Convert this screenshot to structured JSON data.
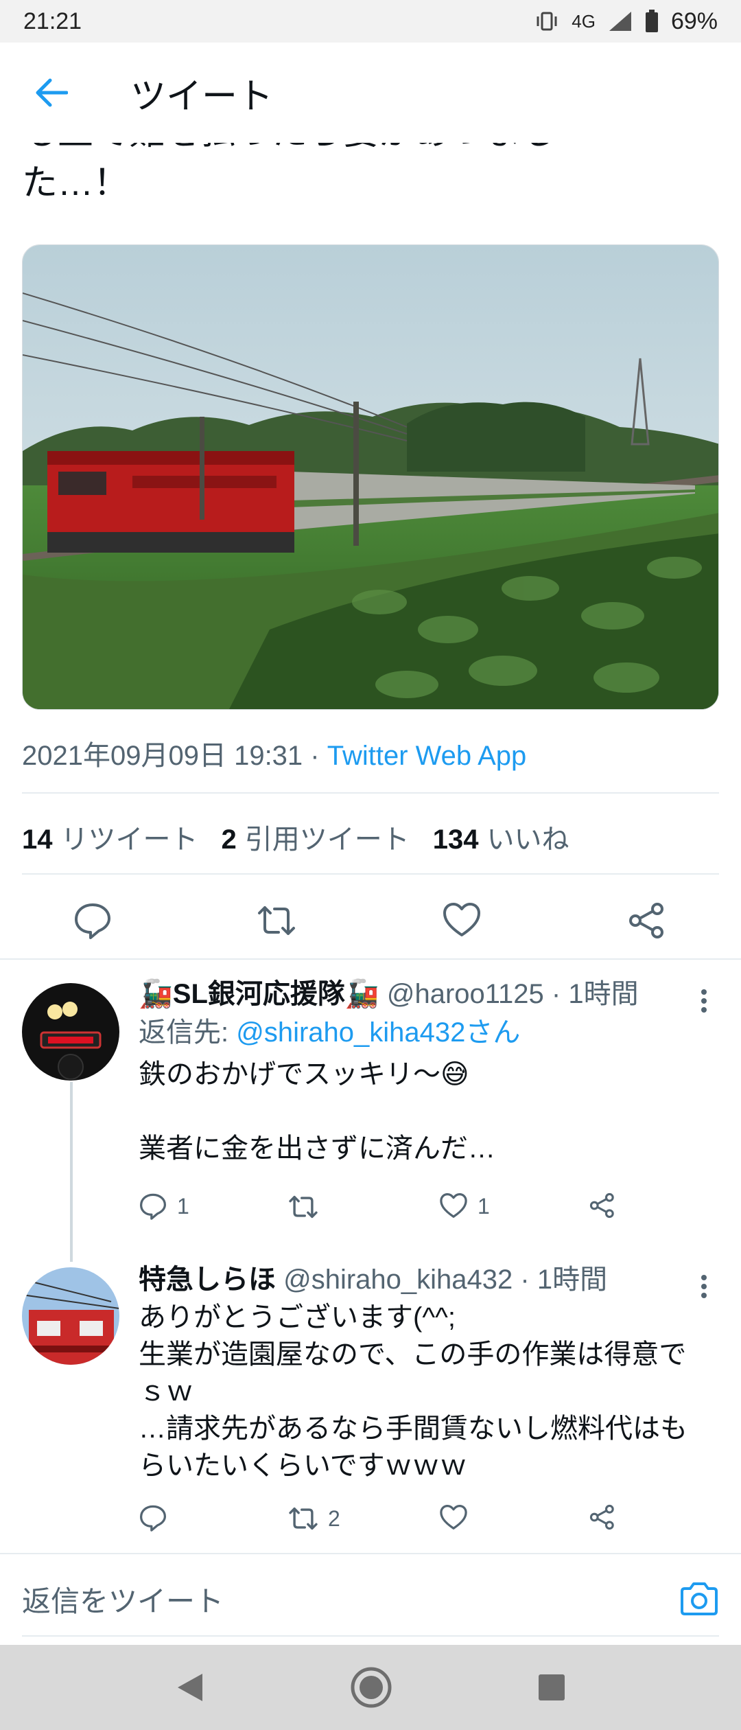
{
  "status_bar": {
    "time": "21:21",
    "network": "4G",
    "battery": "69%"
  },
  "header": {
    "title": "ツイート"
  },
  "tweet": {
    "text_line_partial": "も上で難を払ったら要があつまし",
    "text_line_last": "た…！",
    "image_alt": "red electric locomotive pulling silver passenger train through green field",
    "timestamp": "2021年09月09日 19:31",
    "separator": " · ",
    "source": "Twitter Web App",
    "stats": {
      "retweets_count": "14",
      "retweets_label": "リツイート",
      "quotes_count": "2",
      "quotes_label": "引用ツイート",
      "likes_count": "134",
      "likes_label": "いいね"
    }
  },
  "replies": [
    {
      "name": "🚂SL銀河応援隊🚂",
      "handle": "@haroo1125",
      "time": " · 1時間",
      "reply_to_label": "返信先: ",
      "reply_to_handle": "@shiraho_kiha432さん",
      "text": "鉄のおかげでスッキリ〜😅\n\n業者に金を出さずに済んだ…",
      "reply_count": "1",
      "retweet_count": "",
      "like_count": "1"
    },
    {
      "name": "特急しらほ",
      "handle": "@shiraho_kiha432",
      "time": " · 1時間",
      "text": "ありがとうございます(^^;\n生業が造園屋なので、この手の作業は得意でｓｗ\n…請求先があるなら手間賃ないし燃料代はもらいたいくらいですｗｗｗ",
      "reply_count": "",
      "retweet_count": "2",
      "like_count": ""
    }
  ],
  "composer": {
    "placeholder": "返信をツイート"
  },
  "colors": {
    "accent": "#1d9bf0",
    "text": "#0f1419",
    "secondary": "#536471"
  },
  "icons": {
    "back": "arrow-left-icon",
    "reply": "reply-icon",
    "retweet": "retweet-icon",
    "like": "heart-icon",
    "share": "share-icon",
    "camera": "camera-icon"
  }
}
